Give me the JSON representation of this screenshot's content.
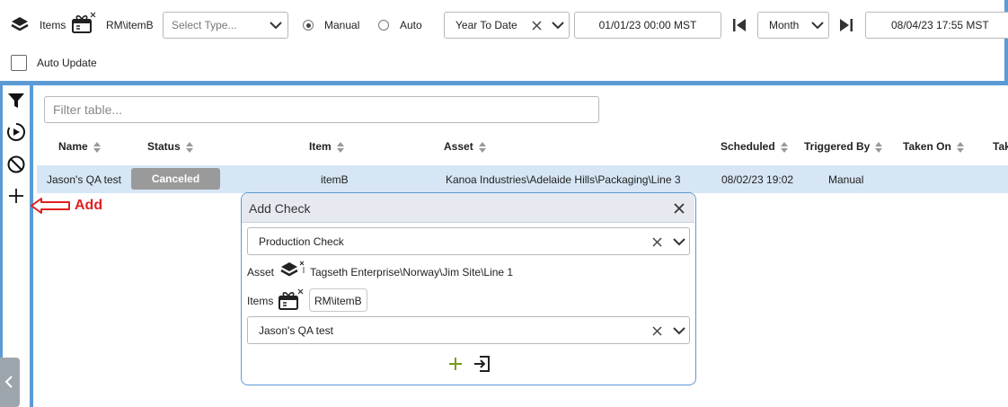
{
  "toolbar": {
    "items_label": "Items",
    "item_value": "RM\\itemB",
    "type_placeholder": "Select Type...",
    "mode_manual": "Manual",
    "mode_auto": "Auto",
    "mode_selected": "Manual",
    "range_value": "Year To Date",
    "start_date": "01/01/23 00:00 MST",
    "period_value": "Month",
    "end_date": "08/04/23 17:55 MST",
    "auto_update_label": "Auto Update",
    "auto_update_checked": false
  },
  "sidebar": {
    "icons": [
      "filter-icon",
      "play-circle-icon",
      "cancel-icon",
      "plus-icon"
    ],
    "annotation": "Add"
  },
  "table": {
    "filter_placeholder": "Filter table...",
    "columns": [
      "Name",
      "Status",
      "Item",
      "Asset",
      "Scheduled",
      "Triggered By",
      "Taken On",
      "Tak"
    ],
    "rows": [
      {
        "name": "Jason's QA test",
        "status": "Canceled",
        "item": "itemB",
        "asset": "Kanoa Industries\\Adelaide Hills\\Packaging\\Line 3",
        "scheduled": "08/02/23 19:02",
        "triggered_by": "Manual",
        "taken_on": ""
      }
    ]
  },
  "dialog": {
    "title": "Add Check",
    "check_type": "Production Check",
    "asset_label": "Asset",
    "asset_value": "Tagseth Enterprise\\Norway\\Jim Site\\Line 1",
    "items_label": "Items",
    "item_chip": "RM\\itemB",
    "check_name": "Jason's QA test"
  },
  "colors": {
    "accent": "#5b9bd5",
    "row_selected": "#d6e6f5",
    "badge_canceled": "#9a9a9a",
    "annotation": "#e02020",
    "add_icon": "#7a9a1a"
  }
}
